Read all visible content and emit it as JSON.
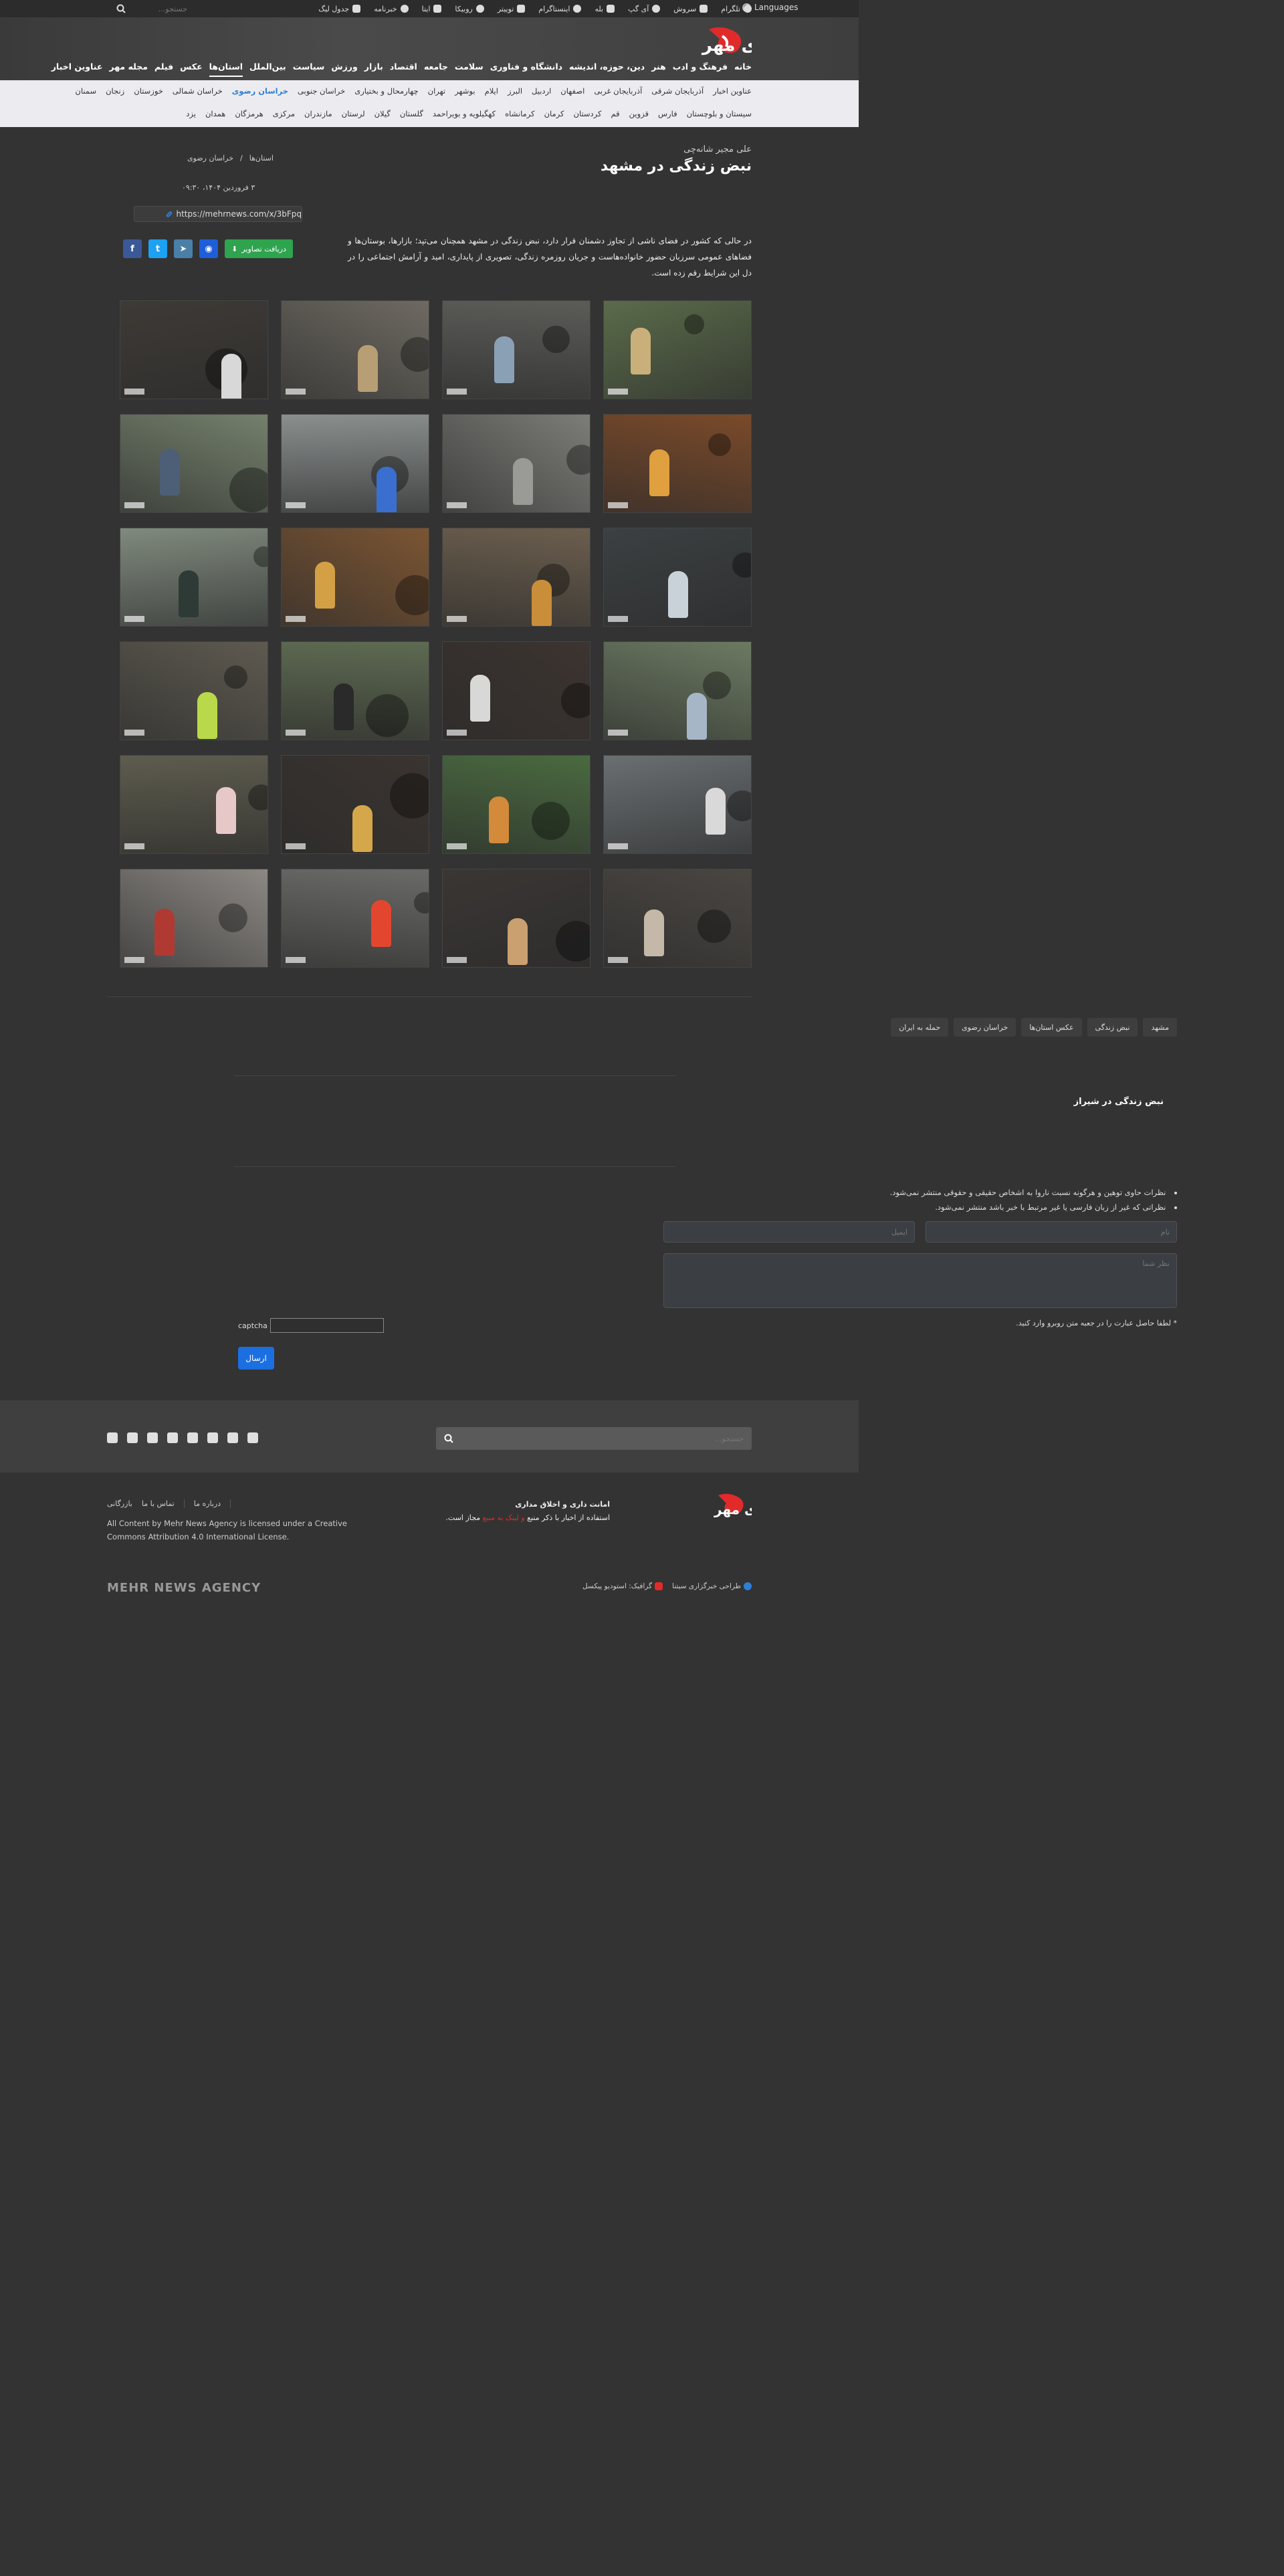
{
  "topbar": {
    "search_placeholder": "جستجو...",
    "links": [
      {
        "label": "تلگرام",
        "icon": "telegram-icon"
      },
      {
        "label": "سروش",
        "icon": "soroush-icon"
      },
      {
        "label": "آی گپ",
        "icon": "igap-icon"
      },
      {
        "label": "بله",
        "icon": "bale-icon"
      },
      {
        "label": "اینستاگرام",
        "icon": "instagram-icon"
      },
      {
        "label": "توییتر",
        "icon": "twitter-icon"
      },
      {
        "label": "روبیکا",
        "icon": "rubika-icon"
      },
      {
        "label": "ایتا",
        "icon": "eitaa-icon"
      },
      {
        "label": "خبرنامه",
        "icon": "newsletter-icon"
      },
      {
        "label": "جدول لیگ",
        "icon": "league-table-icon"
      }
    ],
    "languages": "Languages"
  },
  "header": {
    "logo_text": "خبرگزاری مهر",
    "nav": [
      "خانه",
      "فرهنگ و ادب",
      "هنر",
      "دین، حوزه، اندیشه",
      "دانشگاه و فناوری",
      "سلامت",
      "جامعه",
      "اقتصاد",
      "بازار",
      "ورزش",
      "سیاست",
      "بین‌الملل",
      "استان‌ها",
      "عکس",
      "فیلم",
      "مجله مهر",
      "عناوین اخبار"
    ],
    "active_nav": "استان‌ها"
  },
  "provinces": {
    "row1": [
      "عناوین اخبار",
      "آذربایجان شرقی",
      "آذربایجان غربی",
      "اصفهان",
      "اردبیل",
      "البرز",
      "ایلام",
      "بوشهر",
      "تهران",
      "چهارمحال و بختیاری",
      "خراسان جنوبی",
      "خراسان رضوی",
      "خراسان شمالی",
      "خوزستان",
      "زنجان",
      "سمنان"
    ],
    "row2": [
      "سیستان و بلوچستان",
      "فارس",
      "قزوین",
      "قم",
      "کردستان",
      "کرمان",
      "کرمانشاه",
      "کهگیلویه و بویراحمد",
      "گلستان",
      "گیلان",
      "لرستان",
      "مازندران",
      "مرکزی",
      "هرمزگان",
      "همدان",
      "یزد"
    ],
    "active": "خراسان رضوی"
  },
  "article": {
    "service": "علی مجیر شانه‌چی",
    "title": "نبض زندگی در مشهد",
    "breadcrumb": [
      "استان‌ها",
      "خراسان رضوی"
    ],
    "date": "۳ فروردین ۱۴۰۴، ۰۹:۳۰",
    "short_link": "https://mehrnews.com/x/3bFpq",
    "download_label": "دریافت تصاویر",
    "share": {
      "facebook": "f",
      "twitter": "t",
      "telegram": "➤",
      "whatsapp": "◉"
    },
    "lead": "در حالی که کشور در فضای ناشی از تجاوز دشمنان قرار دارد، نبض زندگی در مشهد همچنان می‌تپد؛ بازارها، بوستان‌ها و فضاهای عمومی سرزبان حضور خانواده‌هاست و جریان روزمره زندگی، تصویری از پایداری، امید و آرامش اجتماعی را در دل این شرایط رقم زده است."
  },
  "gallery": {
    "photos": [
      {
        "name": "photo-shrine-motorcycle",
        "bg": "#5a6b4a",
        "accent": "#c9b07a"
      },
      {
        "name": "photo-street-pedestrians",
        "bg": "#5b5b58",
        "accent": "#8aa0b5"
      },
      {
        "name": "photo-market-street",
        "bg": "#6e6a62",
        "accent": "#b89e74"
      },
      {
        "name": "photo-car-service",
        "bg": "#3e3a36",
        "accent": "#d8d8d8"
      },
      {
        "name": "photo-fruit-shop",
        "bg": "#7a4a2a",
        "accent": "#e0a040"
      },
      {
        "name": "photo-stairs",
        "bg": "#7c7c78",
        "accent": "#9a9a96"
      },
      {
        "name": "photo-sidewalk",
        "bg": "#8a8f8e",
        "accent": "#3a6fd0"
      },
      {
        "name": "photo-park-chess",
        "bg": "#74806c",
        "accent": "#4d5f77"
      },
      {
        "name": "photo-bus-station",
        "bg": "#3c4042",
        "accent": "#c9d2d8"
      },
      {
        "name": "photo-shoe-shop",
        "bg": "#6b5e4e",
        "accent": "#c98e3a"
      },
      {
        "name": "photo-fruit-stall",
        "bg": "#7b5533",
        "accent": "#d3a046"
      },
      {
        "name": "photo-park-acrobat",
        "bg": "#808a7e",
        "accent": "#2e3a36"
      },
      {
        "name": "photo-park-trees",
        "bg": "#6c7a62",
        "accent": "#a7b6c7"
      },
      {
        "name": "photo-portrait-window",
        "bg": "#3c3430",
        "accent": "#d8d8d6"
      },
      {
        "name": "photo-park-walkers",
        "bg": "#5e6a52",
        "accent": "#2a2a2a"
      },
      {
        "name": "photo-vendors-feet",
        "bg": "#5e5a50",
        "accent": "#b9d94a"
      },
      {
        "name": "photo-motorcyclist",
        "bg": "#6a6f72",
        "accent": "#d9d9d9"
      },
      {
        "name": "photo-grocery",
        "bg": "#4a6a40",
        "accent": "#d38a3a"
      },
      {
        "name": "photo-market-shoppers",
        "bg": "#3a3430",
        "accent": "#d4a84a"
      },
      {
        "name": "photo-flower-seller",
        "bg": "#5e5c4e",
        "accent": "#e7c8c8"
      },
      {
        "name": "photo-shop-interior",
        "bg": "#4a4642",
        "accent": "#c4b8a8"
      },
      {
        "name": "photo-cafe-diners",
        "bg": "#3a3634",
        "accent": "#caa070"
      },
      {
        "name": "photo-shop-sign",
        "bg": "#6a6a68",
        "accent": "#e3462e"
      },
      {
        "name": "photo-atm",
        "bg": "#8c8884",
        "accent": "#b03a32"
      }
    ]
  },
  "tags": [
    "مشهد",
    "نبض زندگی",
    "عکس استان‌ها",
    "خراسان رضوی",
    "حمله به ایران"
  ],
  "related": {
    "title": "نبض زندگی در شیراز"
  },
  "comments": {
    "rules": [
      "نظرات حاوی توهین و هرگونه نسبت ناروا به اشخاص حقیقی و حقوقی منتشر نمی‌شود.",
      "نظراتی که غیر از زبان فارسی یا غیر مرتبط با خبر باشد منتشر نمی‌شود."
    ],
    "name_placeholder": "نام",
    "email_placeholder": "ایمیل",
    "comment_placeholder": "نظر شما",
    "captcha_label": "* لطفا حاصل عبارت را در جعبه متن روبرو وارد کنید.",
    "captcha_alt": "captcha",
    "submit_label": "ارسال"
  },
  "footer": {
    "search_placeholder": "جستجو...",
    "copyright_line1": "امانت داری و اخلاق مداری",
    "copyright_line2_a": "استفاده از اخبار با ذکر منبع ",
    "copyright_line2_red": "و لینک به منبع",
    "copyright_line2_b": " مجاز است.",
    "links": [
      "درباره ما",
      "تماس با ما",
      "بازرگانی"
    ],
    "license": "All Content by Mehr News Agency is licensed under a Creative Commons Attribution 4.0 International License.",
    "agency": "MEHR NEWS AGENCY",
    "credits": [
      "طراحی خبرگزاری سیتنا",
      "گرافیک: استودیو پیکسل"
    ]
  },
  "colors": {
    "accent_red": "#e12a2a",
    "accent_blue": "#2e7fd6",
    "download_green": "#2ea44f",
    "submit_blue": "#1c6fe0"
  }
}
